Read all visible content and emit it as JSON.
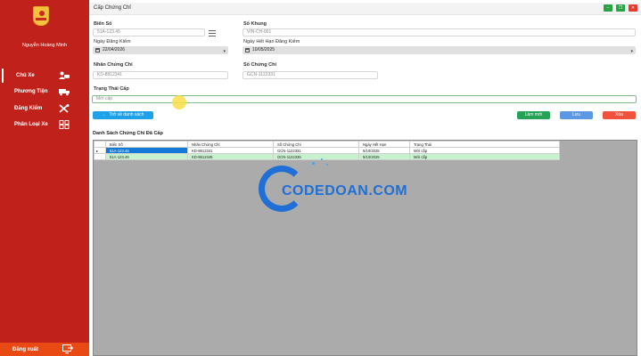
{
  "sidebar": {
    "user_name": "Nguyễn Hoàng Minh",
    "items": [
      {
        "label": "Chủ Xe",
        "icon": "person-car-icon"
      },
      {
        "label": "Phương Tiện",
        "icon": "truck-icon"
      },
      {
        "label": "Đăng Kiểm",
        "icon": "tools-icon"
      },
      {
        "label": "Phân Loại Xe",
        "icon": "grid-icon"
      }
    ],
    "logout_label": "Đăng xuất",
    "logout_icon": "logout-icon",
    "bg_color": "#c0221b"
  },
  "window": {
    "title": "Cấp Chứng Chỉ",
    "controls": [
      "minimize-icon",
      "maximize-icon",
      "close-icon"
    ]
  },
  "form": {
    "bien_so": {
      "label": "Biển Số",
      "value": "51A-123.45"
    },
    "so_khung": {
      "label": "Số Khung",
      "value": "VIN-CH-001"
    },
    "ngay_dang_kiem": {
      "label": "Ngày Đăng Kiểm",
      "value": "22/04/2026"
    },
    "ngay_het_han": {
      "label": "Ngày Hết Hạn Đăng Kiểm",
      "value": "10/05/2025"
    },
    "nhan_chung_chi": {
      "label": "Nhãn Chứng Chỉ",
      "value": "KD-8812341"
    },
    "so_chung_chi": {
      "label": "Số Chứng Chỉ",
      "value": "GCN-1122331"
    },
    "trang_thai": {
      "label": "Trạng Thái Cấp",
      "value": "Mới cấp"
    }
  },
  "buttons": {
    "back": "Trở về danh sách",
    "new": "Làm mới",
    "save": "Lưu",
    "delete": "Xóa"
  },
  "list": {
    "title": "Danh Sách Chứng Chỉ Đã Cấp",
    "columns": [
      "Biển Số",
      "Nhãn Chứng Chỉ",
      "Số Chứng Chỉ",
      "Ngày Hết Hạn",
      "Trạng Thái"
    ],
    "rows": [
      [
        "51A-123.45",
        "KD-8812341",
        "GCN-1122331",
        "5/10/2025",
        "Mới cấp"
      ],
      [
        "51A-123.45",
        "KD-8812345",
        "GCN-1122335",
        "5/10/2025",
        "Mới cấp"
      ]
    ],
    "row_marker": "▸"
  },
  "watermark": "CODEDOAN.COM",
  "colors": {
    "accent_blue": "#1ea1e8",
    "green": "#24a255",
    "save_blue": "#5c97e6",
    "danger": "#f0523b",
    "logout_orange": "#e94a14"
  }
}
